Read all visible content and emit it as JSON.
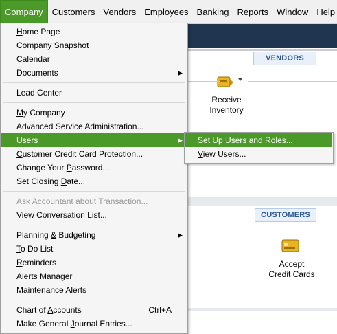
{
  "menubar": {
    "items": [
      {
        "pre": "",
        "key": "C",
        "post": "ompany"
      },
      {
        "pre": "Cu",
        "key": "s",
        "post": "tomers"
      },
      {
        "pre": "Vend",
        "key": "o",
        "post": "rs"
      },
      {
        "pre": "Em",
        "key": "p",
        "post": "loyees"
      },
      {
        "pre": "",
        "key": "B",
        "post": "anking"
      },
      {
        "pre": "",
        "key": "R",
        "post": "eports"
      },
      {
        "pre": "",
        "key": "W",
        "post": "indow"
      },
      {
        "pre": "",
        "key": "H",
        "post": "elp"
      }
    ]
  },
  "home": {
    "vendors_badge": "VENDORS",
    "customers_badge": "CUSTOMERS",
    "receive_inventory": [
      "Receive",
      "Inventory"
    ],
    "accept_cards": [
      "Accept",
      "Credit Cards"
    ]
  },
  "company_menu": {
    "items": [
      {
        "pre": "",
        "key": "H",
        "post": "ome Page"
      },
      {
        "pre": "C",
        "key": "o",
        "post": "mpany Snapshot"
      },
      {
        "pre": "Calendar",
        "key": "",
        "post": ""
      },
      {
        "pre": "Documents",
        "key": "",
        "post": ""
      },
      {
        "pre": "Lead Center",
        "key": "",
        "post": ""
      },
      {
        "pre": "",
        "key": "M",
        "post": "y Company"
      },
      {
        "pre": "Advanced Service Administration...",
        "key": "",
        "post": ""
      },
      {
        "pre": "",
        "key": "U",
        "post": "sers"
      },
      {
        "pre": "",
        "key": "C",
        "post": "ustomer Credit Card Protection..."
      },
      {
        "pre": "Change Your ",
        "key": "P",
        "post": "assword..."
      },
      {
        "pre": "Set Closing ",
        "key": "D",
        "post": "ate..."
      },
      {
        "pre": "",
        "key": "A",
        "post": "sk Accountant about Transaction..."
      },
      {
        "pre": "",
        "key": "V",
        "post": "iew Conversation List..."
      },
      {
        "pre": "Planning ",
        "key": "&",
        "post": " Budgeting"
      },
      {
        "pre": "",
        "key": "T",
        "post": "o Do List"
      },
      {
        "pre": "",
        "key": "R",
        "post": "eminders"
      },
      {
        "pre": "Alerts Manager",
        "key": "",
        "post": ""
      },
      {
        "pre": "Maintenance Alerts",
        "key": "",
        "post": ""
      },
      {
        "pre": "Chart of ",
        "key": "A",
        "post": "ccounts"
      },
      {
        "pre": "Make General ",
        "key": "J",
        "post": "ournal Entries..."
      }
    ],
    "chart_shortcut": "Ctrl+A"
  },
  "users_menu": {
    "items": [
      {
        "pre": "",
        "key": "S",
        "post": "et Up Users and Roles..."
      },
      {
        "pre": "",
        "key": "V",
        "post": "iew Users..."
      }
    ]
  }
}
